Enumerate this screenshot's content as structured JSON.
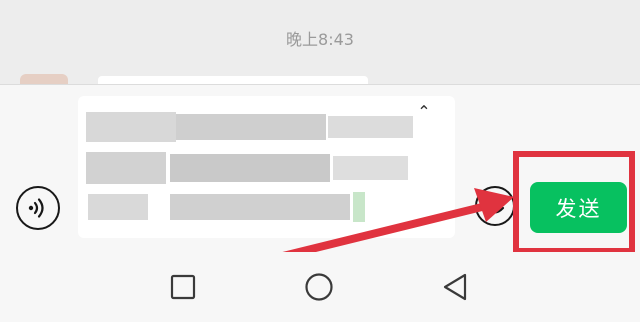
{
  "chat": {
    "timestamp": "晚上8:43"
  },
  "composer": {
    "send_label": "发送",
    "voice_icon": "voice-wave-icon",
    "emoji_icon": "emoji-icon",
    "collapse_icon": "chevron-up-icon",
    "text_obscured": true
  },
  "annotation": {
    "highlight_color": "#e0333f",
    "arrow_color": "#e0333f"
  },
  "colors": {
    "send_button": "#07c160",
    "background": "#ededed"
  },
  "navigation": {
    "icons": [
      "recent-apps-icon",
      "home-icon",
      "back-icon"
    ]
  }
}
